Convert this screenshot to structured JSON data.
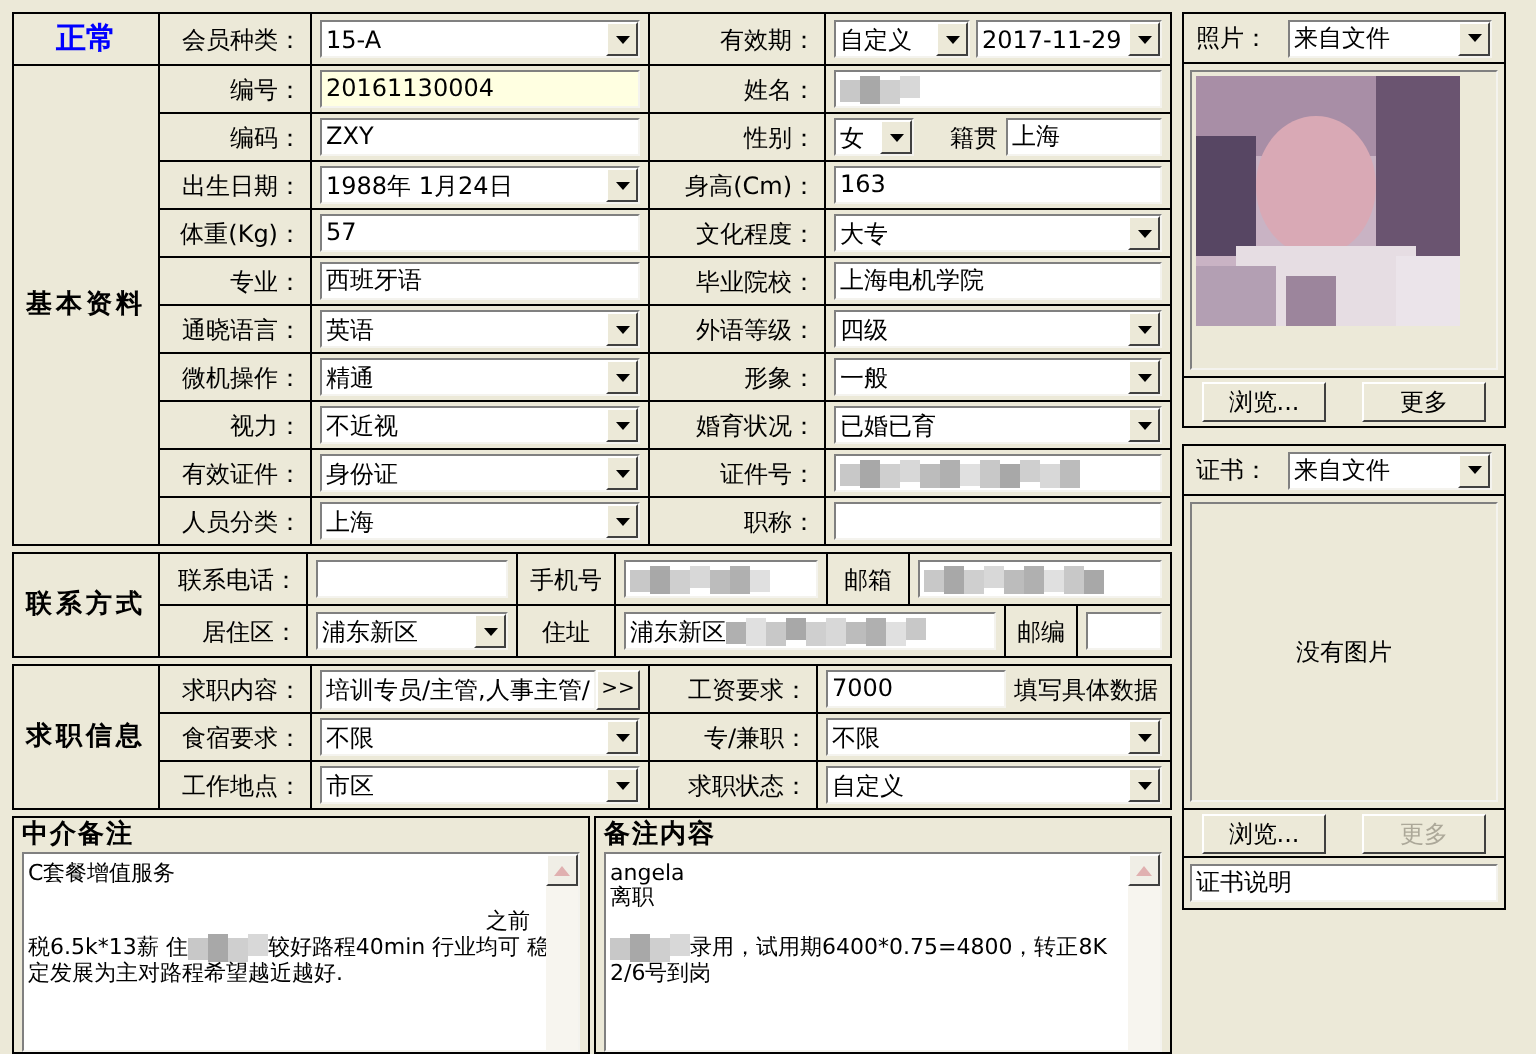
{
  "status": "正常",
  "member_type": {
    "label": "会员种类：",
    "field": {
      "kind": "combo",
      "value": "15-A"
    }
  },
  "validity": {
    "label": "有效期：",
    "mode": {
      "kind": "combo",
      "value": "自定义"
    },
    "date": {
      "kind": "combo",
      "value": "2017-11-29"
    }
  },
  "basic": {
    "title": "基本资料",
    "rows": [
      {
        "label": "编号：",
        "field": {
          "kind": "text",
          "value": "20161130004",
          "highlighted": true
        },
        "label2": "姓名：",
        "field2": {
          "kind": "redacted"
        }
      },
      {
        "label": "编码：",
        "field": {
          "kind": "text",
          "value": "ZXY"
        },
        "label2": "性别：",
        "field2": {
          "kind": "combo_pair",
          "value": "女",
          "extra_label": "籍贯",
          "extra_value": "上海"
        }
      },
      {
        "label": "出生日期：",
        "field": {
          "kind": "combo",
          "value": "1988年 1月24日"
        },
        "label2": "身高(Cm)：",
        "field2": {
          "kind": "text",
          "value": "163"
        }
      },
      {
        "label": "体重(Kg)：",
        "field": {
          "kind": "text",
          "value": "57"
        },
        "label2": "文化程度：",
        "field2": {
          "kind": "combo",
          "value": "大专"
        }
      },
      {
        "label": "专业：",
        "field": {
          "kind": "text",
          "value": "西班牙语"
        },
        "label2": "毕业院校：",
        "field2": {
          "kind": "text",
          "value": "上海电机学院"
        }
      },
      {
        "label": "通晓语言：",
        "field": {
          "kind": "combo",
          "value": "英语"
        },
        "label2": "外语等级：",
        "field2": {
          "kind": "combo",
          "value": "四级"
        }
      },
      {
        "label": "微机操作：",
        "field": {
          "kind": "combo",
          "value": "精通"
        },
        "label2": "形象：",
        "field2": {
          "kind": "combo",
          "value": "一般"
        }
      },
      {
        "label": "视力：",
        "field": {
          "kind": "combo",
          "value": "不近视"
        },
        "label2": "婚育状况：",
        "field2": {
          "kind": "combo",
          "value": "已婚已育"
        }
      },
      {
        "label": "有效证件：",
        "field": {
          "kind": "combo",
          "value": "身份证"
        },
        "label2": "证件号：",
        "field2": {
          "kind": "redacted"
        }
      },
      {
        "label": "人员分类：",
        "field": {
          "kind": "combo",
          "value": "上海"
        },
        "label2": "职称：",
        "field2": {
          "kind": "text"
        }
      }
    ]
  },
  "contact": {
    "title": "联系方式",
    "phone": {
      "label": "联系电话：",
      "field": {
        "kind": "text"
      }
    },
    "mobile": {
      "label": "手机号",
      "field": {
        "kind": "redacted"
      }
    },
    "email": {
      "label": "邮箱",
      "field": {
        "kind": "redacted"
      }
    },
    "district": {
      "label": "居住区：",
      "field": {
        "kind": "combo",
        "value": "浦东新区"
      }
    },
    "address": {
      "label": "住址",
      "field": {
        "kind": "text_redacted",
        "value": "浦东新区"
      }
    },
    "postcode": {
      "label": "邮编",
      "field": {
        "kind": "text"
      }
    }
  },
  "job": {
    "title": "求职信息",
    "content": {
      "label": "求职内容：",
      "field": {
        "kind": "picker",
        "value": "培训专员/主管,人事主管/",
        "button": ">>"
      }
    },
    "salary": {
      "label": "工资要求：",
      "field": {
        "kind": "text",
        "value": "7000"
      },
      "hint": "填写具体数据"
    },
    "lodging": {
      "label": "食宿要求：",
      "field": {
        "kind": "combo",
        "value": "不限"
      }
    },
    "work_type": {
      "label": "专/兼职：",
      "field": {
        "kind": "combo",
        "value": "不限"
      }
    },
    "location": {
      "label": "工作地点：",
      "field": {
        "kind": "combo",
        "value": "市区"
      }
    },
    "job_status": {
      "label": "求职状态：",
      "field": {
        "kind": "combo",
        "value": "自定义"
      }
    }
  },
  "agency_notes": {
    "title": "中介备注",
    "lines": [
      {
        "kind": "text",
        "segments": [
          {
            "kind": "text",
            "text": "C套餐增值服务"
          }
        ]
      },
      {
        "kind": "blank"
      },
      {
        "kind": "right_text",
        "segments": [
          {
            "kind": "text",
            "text": "之前"
          }
        ]
      },
      {
        "kind": "text",
        "segments": [
          {
            "kind": "text",
            "text": "税6.5k*13薪 住"
          },
          {
            "kind": "redacted"
          },
          {
            "kind": "text",
            "text": "较好路程40min 行业均可 稳"
          }
        ]
      },
      {
        "kind": "text",
        "segments": [
          {
            "kind": "text",
            "text": "定发展为主对路程希望越近越好."
          }
        ]
      }
    ]
  },
  "remarks": {
    "title": "备注内容",
    "lines": [
      {
        "kind": "text",
        "segments": [
          {
            "kind": "text",
            "text": "angela"
          }
        ]
      },
      {
        "kind": "text",
        "segments": [
          {
            "kind": "text",
            "text": "离职"
          }
        ]
      },
      {
        "kind": "blank"
      },
      {
        "kind": "text",
        "segments": [
          {
            "kind": "redacted"
          },
          {
            "kind": "text",
            "text": "录用，试用期6400*0.75=4800，转正8K"
          }
        ]
      },
      {
        "kind": "text",
        "segments": [
          {
            "kind": "text",
            "text": "2/6号到岗"
          }
        ]
      }
    ]
  },
  "photo": {
    "label": "照片：",
    "source": {
      "kind": "combo",
      "value": "来自文件"
    },
    "buttons": [
      {
        "label": "浏览...",
        "disabled": false
      },
      {
        "label": "更多",
        "disabled": false
      }
    ]
  },
  "certificate": {
    "label": "证书：",
    "source": {
      "kind": "combo",
      "value": "来自文件"
    },
    "empty_text": "没有图片",
    "buttons": [
      {
        "label": "浏览...",
        "disabled": false
      },
      {
        "label": "更多",
        "disabled": true
      }
    ],
    "caption": {
      "kind": "text",
      "value": "证书说明"
    }
  }
}
